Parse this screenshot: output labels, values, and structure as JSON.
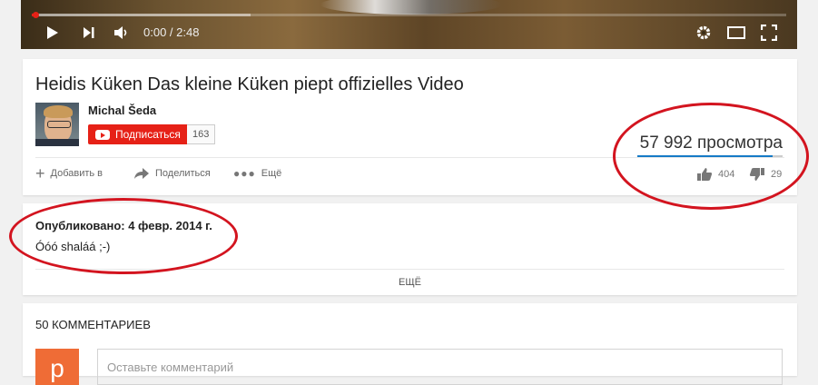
{
  "player": {
    "time": "0:00 / 2:48",
    "progress_played": 0.005,
    "progress_loaded": 0.29,
    "accent": "#e62117"
  },
  "video": {
    "title": "Heidis Küken Das kleine Küken piept offizielles Video",
    "channel": "Michal Šeda",
    "subscribe_label": "Подписаться",
    "subscriber_count": "163",
    "views": "57 992 просмотра",
    "like_ratio": 0.933
  },
  "actions": {
    "add_label": "Добавить в",
    "share_label": "Поделиться",
    "more_label": "Ещё",
    "likes": "404",
    "dislikes": "29"
  },
  "description": {
    "published": "Опубликовано: 4 февр. 2014 г.",
    "text": "Óóó shaláá ;-)",
    "more_label": "ЕЩЁ"
  },
  "comments": {
    "count_label": "50 КОММЕНТАРИЕВ",
    "avatar_letter": "p",
    "placeholder": "Оставьте комментарий"
  },
  "icons": [
    "play-icon",
    "next-icon",
    "volume-icon",
    "settings-icon",
    "theater-icon",
    "fullscreen-icon",
    "add-icon",
    "share-icon",
    "more-icon",
    "like-icon",
    "dislike-icon",
    "youtube-logo-icon"
  ],
  "colors": {
    "annotation": "#d3141f",
    "views_bar": "#167ac6",
    "comment_avatar": "#ef6c36"
  }
}
